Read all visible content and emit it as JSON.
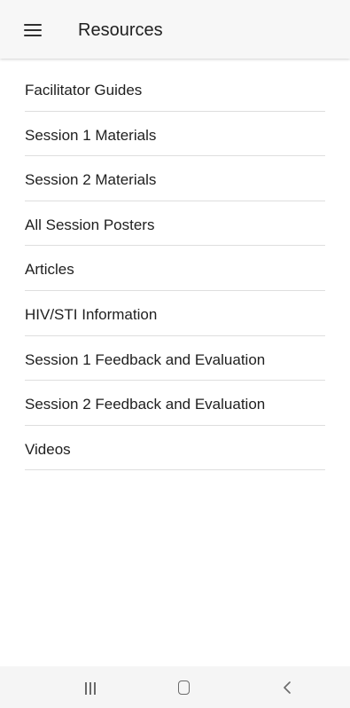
{
  "app_bar": {
    "title": "Resources",
    "menu_icon": "hamburger-menu-icon"
  },
  "resources": {
    "items": [
      {
        "label": "Facilitator Guides"
      },
      {
        "label": "Session 1 Materials"
      },
      {
        "label": "Session 2 Materials"
      },
      {
        "label": "All Session Posters"
      },
      {
        "label": "Articles"
      },
      {
        "label": "HIV/STI Information"
      },
      {
        "label": "Session 1 Feedback and Evaluation"
      },
      {
        "label": "Session 2 Feedback and Evaluation"
      },
      {
        "label": "Videos"
      }
    ]
  },
  "nav_bar": {
    "recent_icon": "recent-apps-icon",
    "home_icon": "home-icon",
    "back_icon": "back-icon"
  },
  "colors": {
    "app_bar_background": "#f7f7f7",
    "divider": "#dedede",
    "text": "#202020",
    "nav_bar_background": "#f5f5f5"
  }
}
